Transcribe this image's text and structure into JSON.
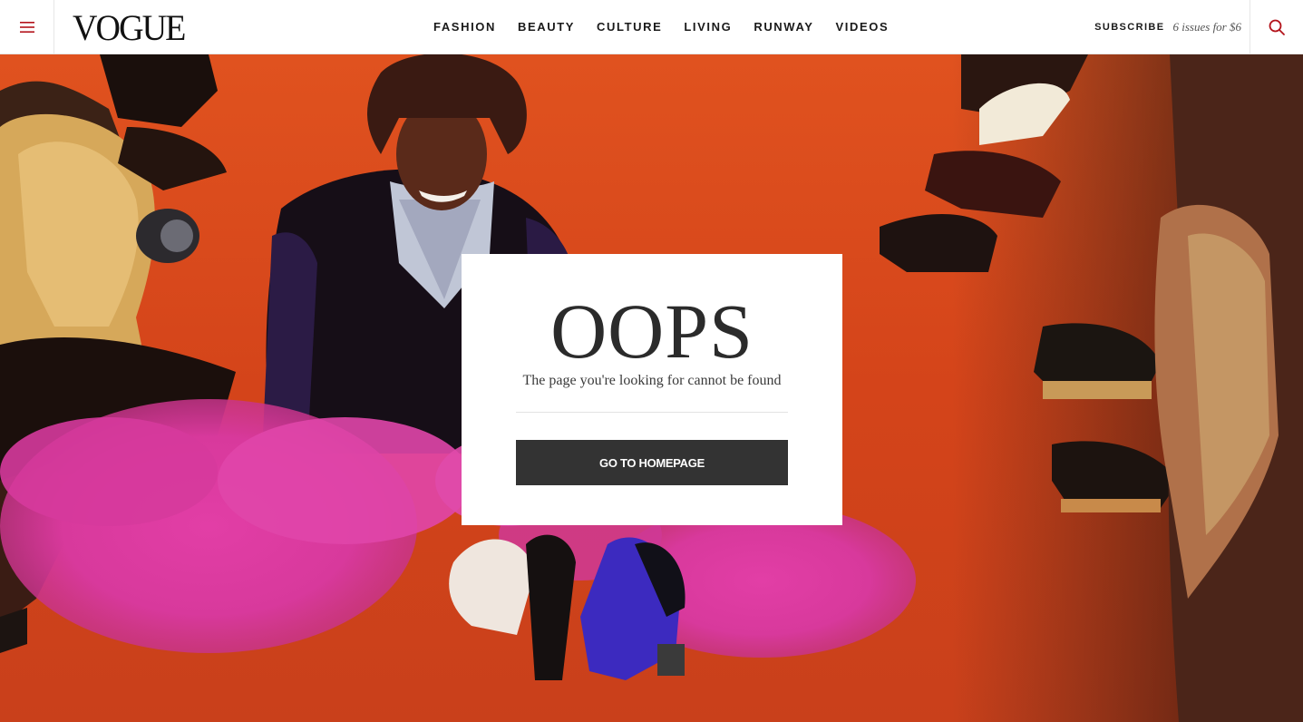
{
  "brand": {
    "logo_text": "VOGUE",
    "accent_color": "#b3131b"
  },
  "header": {
    "menu_icon": "hamburger-menu-icon",
    "nav_items": [
      {
        "label": "FASHION"
      },
      {
        "label": "BEAUTY"
      },
      {
        "label": "CULTURE"
      },
      {
        "label": "LIVING"
      },
      {
        "label": "RUNWAY"
      },
      {
        "label": "VIDEOS"
      }
    ],
    "subscribe_label": "SUBSCRIBE",
    "subscribe_offer": "6 issues for $6",
    "search_icon": "search-icon"
  },
  "error_card": {
    "heading": "OOPS",
    "message": "The page you're looking for cannot be found",
    "button_label": "GO TO HOMEPAGE",
    "button_color": "#333333"
  },
  "hero": {
    "carpet_color": "#d3461d"
  }
}
